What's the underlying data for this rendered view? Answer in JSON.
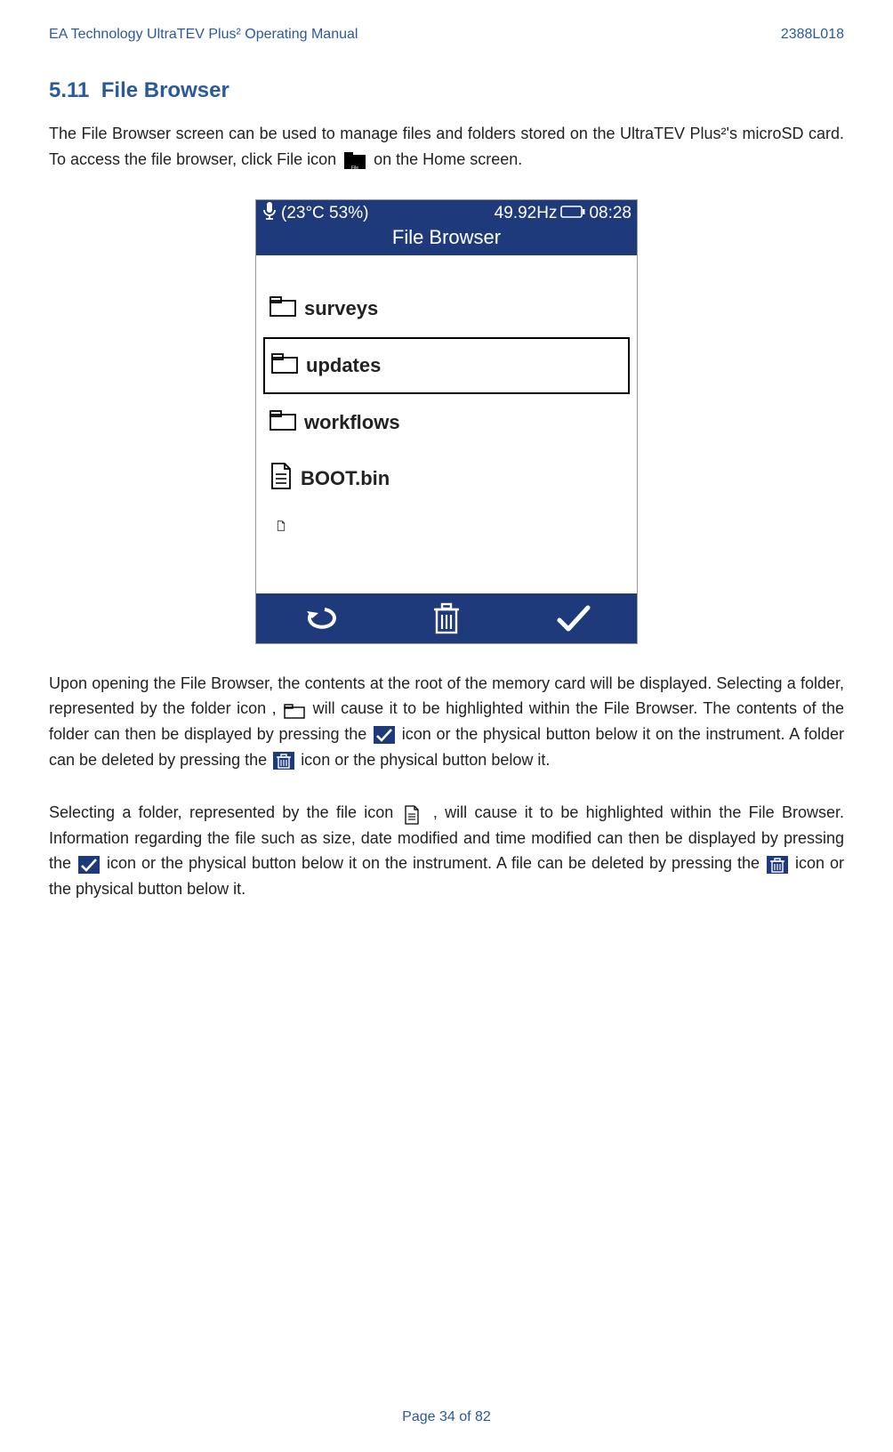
{
  "header": {
    "left": "EA Technology UltraTEV Plus² Operating Manual",
    "right": "2388L018"
  },
  "section": {
    "number": "5.11",
    "title": "File Browser"
  },
  "intro": {
    "part1": "The File Browser screen can be used to manage files and folders stored on the UltraTEV Plus²'s microSD card. To access the file browser, click File icon ",
    "part2": " on the Home screen."
  },
  "device": {
    "status": {
      "temp_humidity": "(23°C  53%)",
      "frequency": "49.92Hz",
      "time": "08:28"
    },
    "title": "File Browser",
    "items": [
      {
        "type": "folder",
        "name": "surveys",
        "selected": false
      },
      {
        "type": "folder",
        "name": "updates",
        "selected": true
      },
      {
        "type": "folder",
        "name": "workflows",
        "selected": false
      },
      {
        "type": "file",
        "name": "BOOT.bin",
        "selected": false
      }
    ]
  },
  "body2": {
    "p1a": "Upon opening the File Browser, the contents at the root of the memory card will be displayed. Selecting a folder, represented by the folder icon ,",
    "p1b": " will cause it to be highlighted within the File Browser. The contents of the folder can then be displayed by pressing the ",
    "p1c": " icon or the physical button below it on the instrument. A folder can be deleted by pressing the ",
    "p1d": " icon or the physical button below it.",
    "p2a": "Selecting a folder, represented by the file icon ",
    "p2b": ", will cause it to be highlighted within the File Browser. Information regarding the file such as size, date modified and time modified can then be displayed by pressing the ",
    "p2c": " icon or the physical button below it on the instrument. A file can be deleted by pressing the ",
    "p2d": " icon or the physical button below it."
  },
  "footer": "Page 34 of 82"
}
